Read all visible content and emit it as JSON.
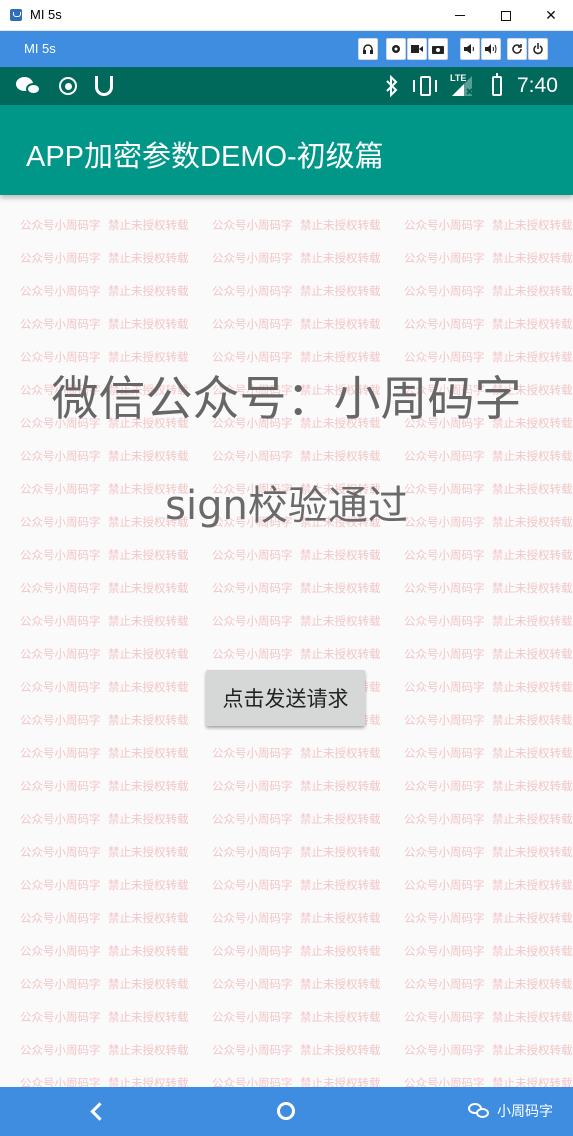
{
  "window": {
    "title": "MI 5s",
    "controls": {
      "minimize": "minimize-icon",
      "maximize": "maximize-icon",
      "close": "✕"
    }
  },
  "emulator_bar": {
    "device_name": "MI 5s",
    "buttons": [
      "headphones-icon",
      "settings-icon",
      "video-icon",
      "camera-icon",
      "volume-down-icon",
      "volume-up-icon",
      "rotate-icon",
      "power-icon"
    ]
  },
  "status_bar": {
    "left_icons": [
      "wechat-icon",
      "record-icon",
      "shield-icon"
    ],
    "right_icons": [
      "bluetooth-icon",
      "vibrate-icon",
      "lte-signal-icon",
      "battery-charging-icon"
    ],
    "network": "LTE",
    "time": "7:40",
    "color": "#00695c"
  },
  "toolbar": {
    "title": "APP加密参数DEMO-初级篇",
    "color": "#009688"
  },
  "watermark": {
    "text_a": "公众号小周码字",
    "text_b": "禁止未授权转载",
    "color": "#f3c6c8"
  },
  "main": {
    "headline": "微信公众号：小周码字",
    "status_text": "sign校验通过",
    "send_button": "点击发送请求"
  },
  "nav_bar": {
    "back": "back-icon",
    "home": "home-icon",
    "badge_text": "小周码字",
    "color": "#3f8de0"
  }
}
